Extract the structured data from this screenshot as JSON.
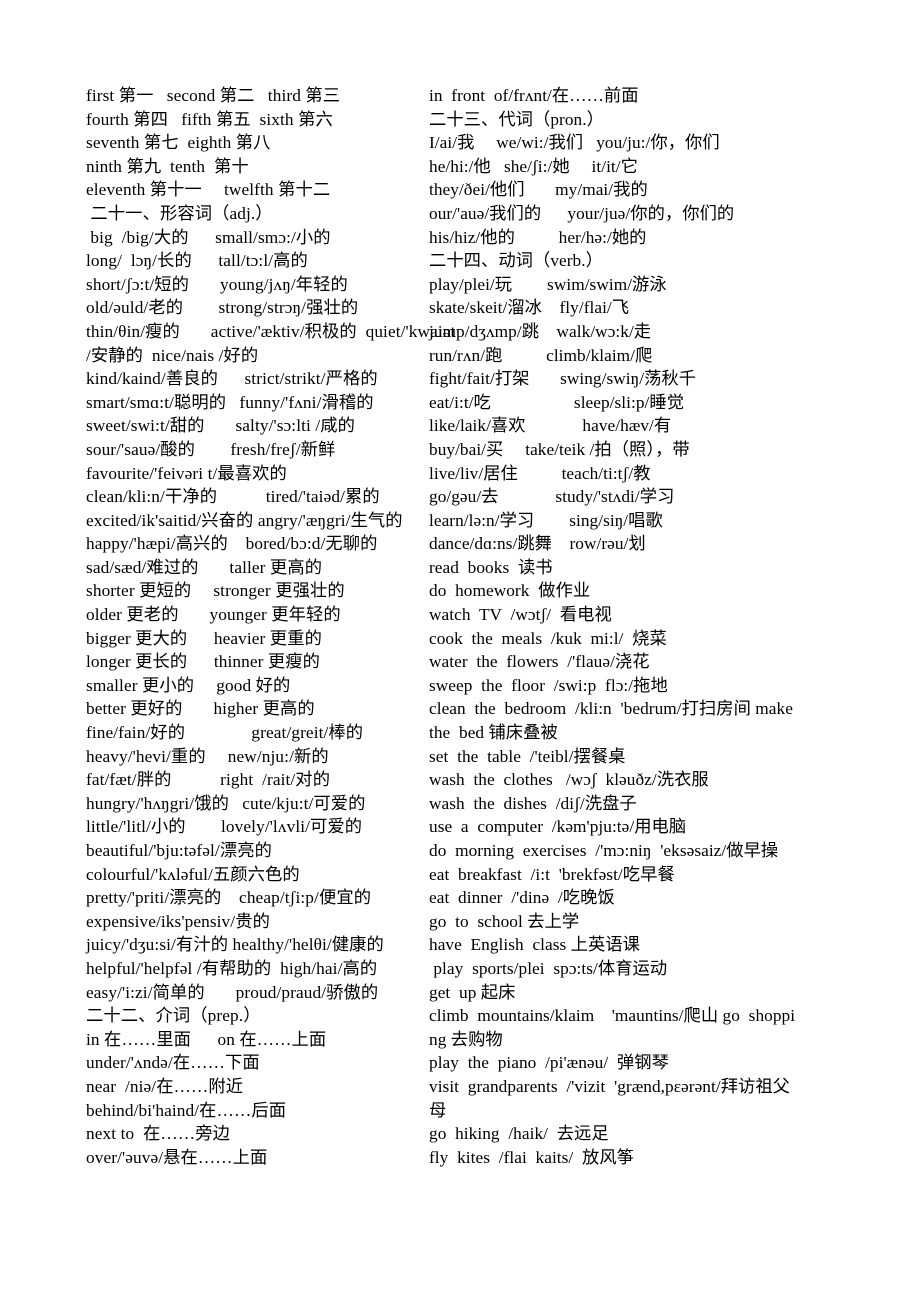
{
  "document": {
    "type": "vocabulary-study-sheet",
    "language_pair": "English-Chinese",
    "columns": 2
  },
  "left_column": {
    "lines": [
      "first 第一   second 第二   third 第三",
      "fourth 第四   fifth 第五  sixth 第六",
      "seventh 第七  eighth 第八",
      "ninth 第九  tenth  第十",
      "eleventh 第十一     twelfth 第十二",
      " 二十一、形容词（adj.）",
      " big  /big/大的      small/smɔ:/小的",
      "long/  lɔŋ/长的      tall/tɔ:l/高的",
      "short/ʃɔ:t/短的       young/jʌŋ/年轻的",
      "old/əuld/老的        strong/strɔŋ/强壮的",
      "thin/θin/瘦的       active/'æktiv/积极的  quiet/'kwaiət",
      "/安静的  nice/nais /好的",
      "kind/kaind/善良的      strict/strikt/严格的",
      "smart/smɑ:t/聪明的   funny/'fʌni/滑稽的",
      "sweet/swi:t/甜的       salty/'sɔ:lti /咸的",
      "sour/'sauə/酸的        fresh/freʃ/新鲜",
      "favourite/'feivəri t/最喜欢的",
      "clean/kli:n/干净的           tired/'taiəd/累的",
      "excited/ik'saitid/兴奋的 angry/'æŋgri/生气的",
      "happy/'hæpi/高兴的    bored/bɔ:d/无聊的",
      "sad/sæd/难过的       taller 更高的",
      "shorter 更短的     stronger 更强壮的",
      "older 更老的       younger 更年轻的",
      "bigger 更大的      heavier 更重的",
      "longer 更长的      thinner 更瘦的",
      "smaller 更小的     good 好的",
      "better 更好的       higher 更高的",
      "fine/fain/好的               great/greit/棒的",
      "heavy/'hevi/重的     new/nju:/新的",
      "fat/fæt/胖的           right  /rait/对的",
      "hungry/'hʌŋgri/饿的   cute/kju:t/可爱的",
      "little/'litl/小的        lovely/'lʌvli/可爱的",
      "beautiful/'bju:təfəl/漂亮的",
      "colourful/'kʌləful/五颜六色的",
      "pretty/'priti/漂亮的    cheap/tʃi:p/便宜的",
      "expensive/iks'pensiv/贵的",
      "juicy/'dʒu:si/有汁的 healthy/'helθi/健康的",
      "helpful/'helpfəl /有帮助的  high/hai/高的",
      "easy/'i:zi/简单的       proud/praud/骄傲的",
      "二十二、介词（prep.）",
      "in 在……里面      on 在……上面",
      "under/'ʌndə/在……下面",
      "near  /niə/在……附近",
      "behind/bi'haind/在……后面",
      "next to  在……旁边",
      "over/'əuvə/悬在……上面"
    ]
  },
  "right_column": {
    "lines": [
      "in  front  of/frʌnt/在……前面",
      "二十三、代词（pron.）",
      "I/ai/我     we/wi:/我们   you/ju:/你，你们",
      "he/hi:/他   she/ʃi:/她     it/it/它",
      "they/ðei/他们       my/mai/我的",
      "our/'auə/我们的      your/juə/你的，你们的",
      "his/hiz/他的          her/hə:/她的",
      "二十四、动词（verb.）",
      "play/plei/玩        swim/swim/游泳",
      "skate/skeit/溜冰    fly/flai/飞",
      "jump/dʒʌmp/跳    walk/wɔ:k/走",
      "run/rʌn/跑          climb/klaim/爬",
      "fight/fait/打架       swing/swiŋ/荡秋千",
      "eat/i:t/吃                   sleep/sli:p/睡觉",
      "like/laik/喜欢             have/hæv/有",
      "buy/bai/买     take/teik /拍（照），带",
      "live/liv/居住          teach/ti:tʃ/教",
      "go/gəu/去             study/'stʌdi/学习",
      "learn/lə:n/学习        sing/siŋ/唱歌",
      "dance/dɑ:ns/跳舞    row/rəu/划",
      "read  books  读书",
      "do  homework  做作业",
      "watch  TV  /wɔtʃ/  看电视",
      "cook  the  meals  /kuk  mi:l/  烧菜",
      "water  the  flowers  /'flauə/浇花",
      "sweep  the  floor  /swi:p  flɔ:/拖地",
      "clean  the  bedroom  /kli:n  'bedrum/打扫房间 make",
      "the  bed 铺床叠被",
      "set  the  table  /'teibl/摆餐桌",
      "wash  the  clothes   /wɔʃ  kləuðz/洗衣服",
      "wash  the  dishes  /diʃ/洗盘子",
      "use  a  computer  /kəm'pju:tə/用电脑",
      "do  morning  exercises  /'mɔ:niŋ  'eksəsaiz/做早操",
      "eat  breakfast  /i:t  'brekfəst/吃早餐",
      "eat  dinner  /'dinə  /吃晚饭",
      "go  to  school 去上学",
      "have  English  class 上英语课",
      " play  sports/plei  spɔ:ts/体育运动",
      "get  up 起床",
      "climb  mountains/klaim    'mauntins/爬山 go  shoppi",
      "ng 去购物",
      "play  the  piano  /pi'ænəu/  弹钢琴",
      "visit  grandparents  /'vizit  'grænd,pɛərənt/拜访祖父",
      "母",
      "go  hiking  /haik/  去远足",
      "fly  kites  /flai  kaits/  放风筝"
    ]
  }
}
